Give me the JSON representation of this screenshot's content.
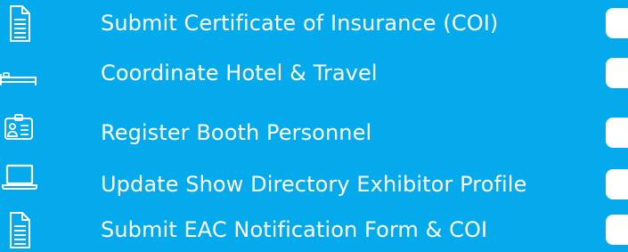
{
  "colors": {
    "background": "#04aaeb",
    "foreground": "#ffffff"
  },
  "checklist": {
    "items": [
      {
        "label": "Submit Certificate of Insurance (COI)",
        "icon": "document-icon",
        "checked": false
      },
      {
        "label": "Coordinate Hotel & Travel",
        "icon": "bed-icon",
        "checked": false
      },
      {
        "label": "Register Booth Personnel",
        "icon": "id-badge-icon",
        "checked": false
      },
      {
        "label": "Update Show Directory Exhibitor Profile",
        "icon": "laptop-icon",
        "checked": false
      },
      {
        "label": "Submit EAC Notification Form & COI",
        "icon": "document-icon",
        "checked": false
      }
    ]
  }
}
